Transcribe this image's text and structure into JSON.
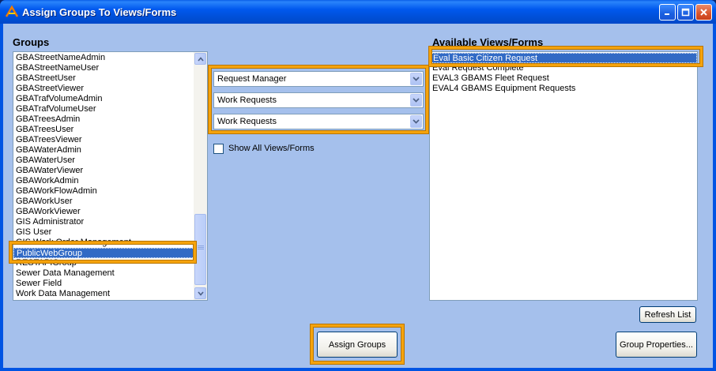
{
  "window": {
    "title": "Assign Groups To Views/Forms"
  },
  "groups": {
    "heading": "Groups",
    "items": [
      "GBAStreetNameAdmin",
      "GBAStreetNameUser",
      "GBAStreetUser",
      "GBAStreetViewer",
      "GBATrafVolumeAdmin",
      "GBATrafVolumeUser",
      "GBATreesAdmin",
      "GBATreesUser",
      "GBATreesViewer",
      "GBAWaterAdmin",
      "GBAWaterUser",
      "GBAWaterViewer",
      "GBAWorkAdmin",
      "GBAWorkFlowAdmin",
      "GBAWorkUser",
      "GBAWorkViewer",
      "GIS Administrator",
      "GIS User",
      "GIS Work Order Management",
      "PublicWebGroup",
      "RESTAPIGroup",
      "Sewer Data Management",
      "Sewer Field",
      "Work Data Management"
    ],
    "selected": "PublicWebGroup"
  },
  "middle": {
    "combo1": "Request Manager",
    "combo2": "Work Requests",
    "combo3": "Work Requests",
    "show_all_label": "Show All Views/Forms"
  },
  "views": {
    "heading": "Available Views/Forms",
    "items": [
      "Eval Basic Citizen Request",
      "Eval Request Complete",
      "EVAL3 GBAMS Fleet Request",
      "EVAL4 GBAMS Equipment Requests"
    ],
    "selected": "Eval Basic Citizen Request"
  },
  "buttons": {
    "refresh": "Refresh List",
    "assign": "Assign Groups",
    "properties": "Group Properties..."
  },
  "colors": {
    "highlight": "#f5a30c",
    "selection": "#316ac5",
    "client_bg": "#a5c0ec"
  }
}
